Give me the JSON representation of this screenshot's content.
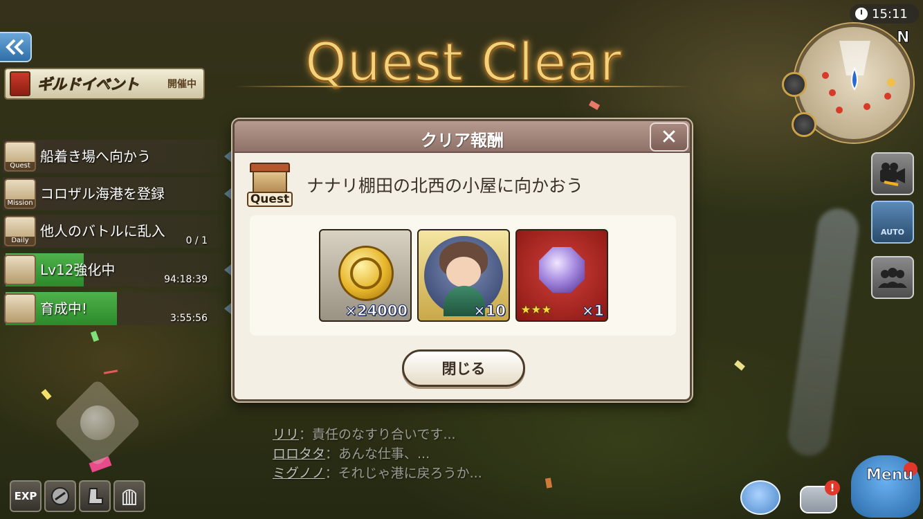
{
  "title": "Quest Clear",
  "clock": "15:11",
  "compass": "N",
  "guild_event": {
    "label": "ギルドイベント",
    "status": "開催中"
  },
  "quests": [
    {
      "icon": "quest-house-icon",
      "caption": "Quest",
      "label": "船着き場へ向かう",
      "sub": ""
    },
    {
      "icon": "mission-icon",
      "caption": "Mission",
      "label": "コロザル海港を登録",
      "sub": ""
    },
    {
      "icon": "daily-scroll-icon",
      "caption": "Daily",
      "label": "他人のバトルに乱入",
      "sub": "0 / 1"
    },
    {
      "icon": "workbench-icon",
      "caption": "",
      "label": "Lv12強化中",
      "sub": "94:18:39",
      "progress": 0.35
    },
    {
      "icon": "workbench-icon",
      "caption": "",
      "label": "育成中!",
      "sub": "3:55:56",
      "progress": 0.5
    }
  ],
  "bottom_left": {
    "exp_label": "EXP"
  },
  "right_buttons": {
    "auto_label": "AUTO"
  },
  "chat": [
    {
      "name": "リリ",
      "text": "：責任のなすり合いです..."
    },
    {
      "name": "ロロタタ",
      "text": "：あんな仕事、..."
    },
    {
      "name": "ミグノノ",
      "text": "：それじゃ港に戻ろうか..."
    }
  ],
  "menu_label": "Menu",
  "dialog": {
    "title": "クリア報酬",
    "close": "✕",
    "quest_caption": "Quest",
    "quest_name": "ナナリ棚田の北西の小屋に向かおう",
    "rewards": [
      {
        "type": "coin",
        "icon": "gold-coin-icon",
        "qty": "×24000"
      },
      {
        "type": "character",
        "icon": "character-portrait-icon",
        "qty": "×10"
      },
      {
        "type": "gem",
        "icon": "purple-gem-icon",
        "qty": "×1",
        "stars": "★★★"
      }
    ],
    "close_button": "閉じる"
  },
  "colors": {
    "title_gold": "#f3d27c",
    "dialog_bg": "#f3efe4",
    "header": "#9e8278",
    "progress_green": "#3ea13a"
  }
}
